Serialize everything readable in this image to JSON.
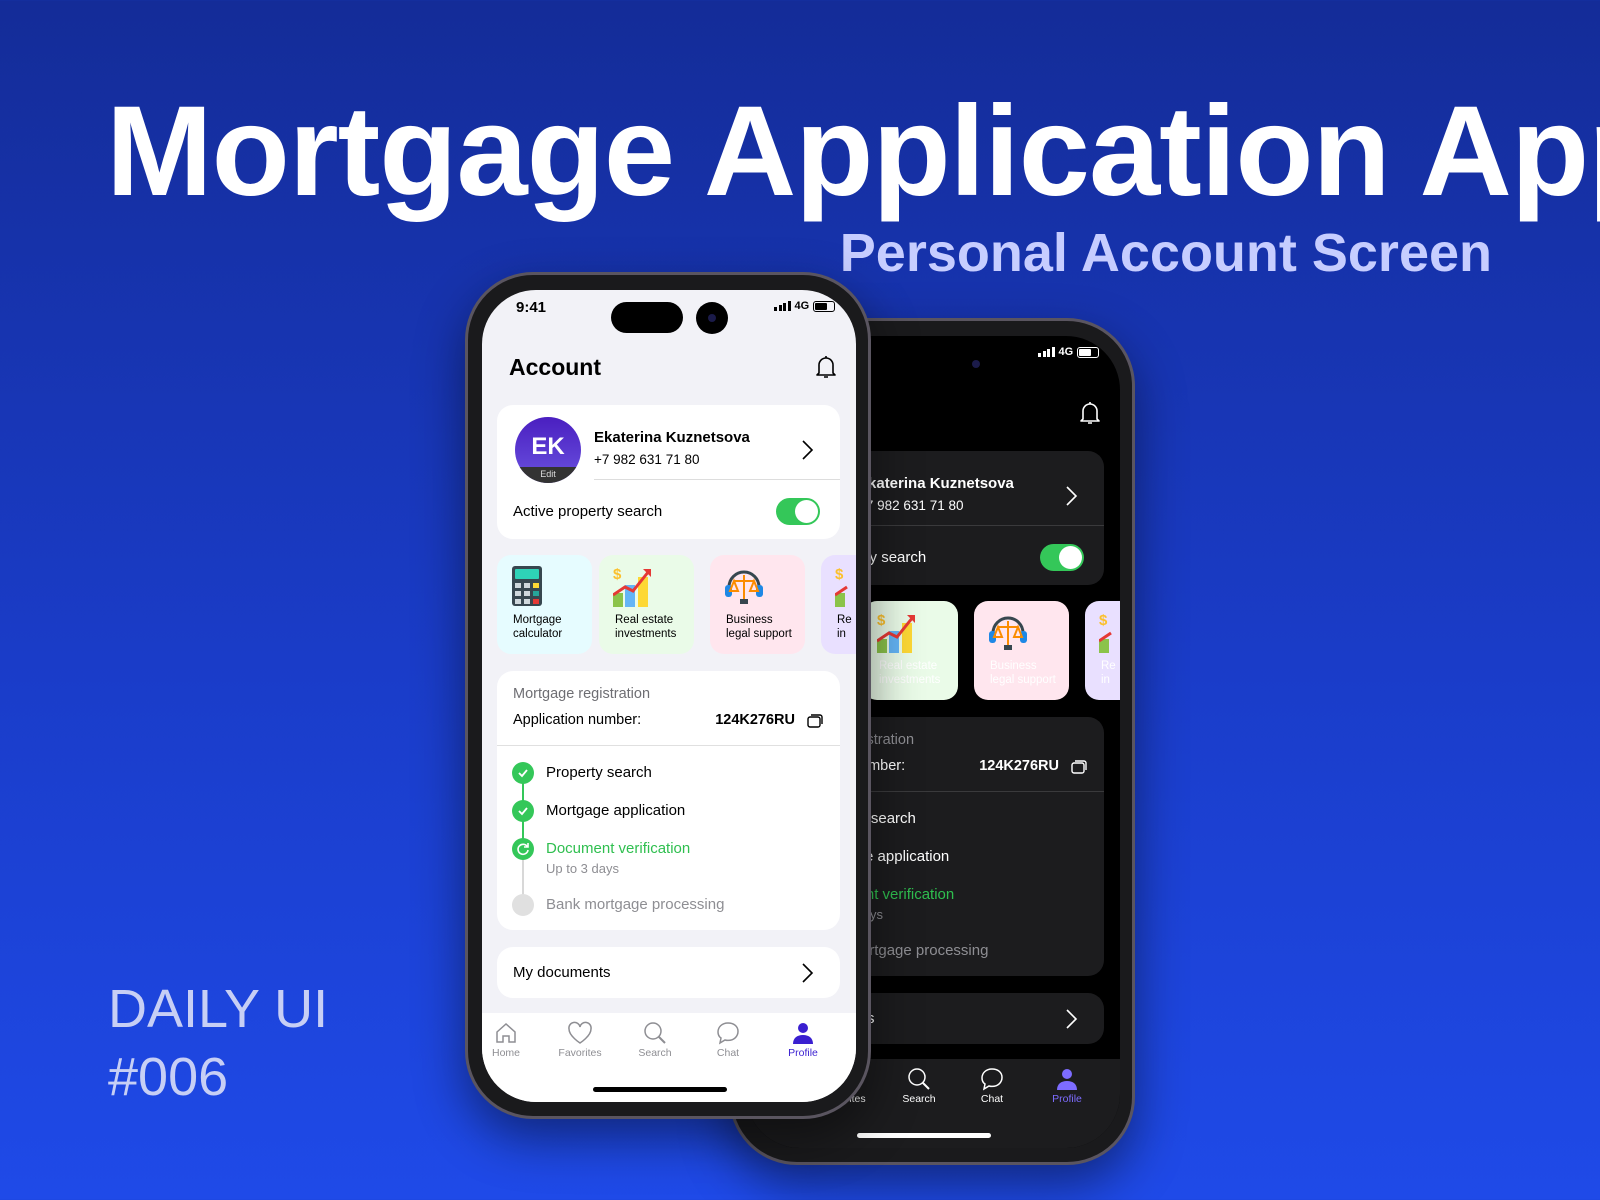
{
  "poster": {
    "title": "Mortgage Application App",
    "subtitle": "Personal Account Screen",
    "daily_line1": "DAILY UI",
    "daily_line2": "#006"
  },
  "status": {
    "time": "9:41",
    "network": "4G"
  },
  "header": {
    "title": "Account",
    "icon": "bell-icon"
  },
  "profile": {
    "initials": "EK",
    "edit_label": "Edit",
    "name": "Ekaterina Kuznetsova",
    "phone": "+7 982 631 71 80",
    "avatar_color": "#4a1fc0",
    "active_search_label": "Active property search",
    "active_search_on": true,
    "toggle_color": "#34c759"
  },
  "services": [
    {
      "line1": "Mortgage",
      "line2": "calculator",
      "icon": "calculator-icon",
      "bg": "#e6fcff"
    },
    {
      "line1": "Real estate",
      "line2": "investments",
      "icon": "growth-chart-icon",
      "bg": "#eafbe8"
    },
    {
      "line1": "Business",
      "line2": "legal support",
      "icon": "legal-support-icon",
      "bg": "#ffe6ee"
    },
    {
      "line1": "Re",
      "line2": "in",
      "icon": "growth-chart-icon",
      "bg": "#e9e0ff"
    }
  ],
  "registration": {
    "title": "Mortgage registration",
    "app_number_label": "Application number:",
    "app_number": "124K276RU",
    "steps": [
      {
        "label": "Property search",
        "status": "done"
      },
      {
        "label": "Mortgage application",
        "status": "done"
      },
      {
        "label": "Document verification",
        "sub": "Up to 3 days",
        "status": "in-progress"
      },
      {
        "label": "Bank mortgage processing",
        "status": "pending"
      }
    ]
  },
  "documents": {
    "label": "My documents"
  },
  "tabs": [
    {
      "label": "Home"
    },
    {
      "label": "Favorites"
    },
    {
      "label": "Search"
    },
    {
      "label": "Chat"
    },
    {
      "label": "Profile",
      "active": true
    }
  ],
  "colors": {
    "accent": "#3a1fd0",
    "success": "#34c759",
    "dark_accent": "#7d6cff"
  }
}
